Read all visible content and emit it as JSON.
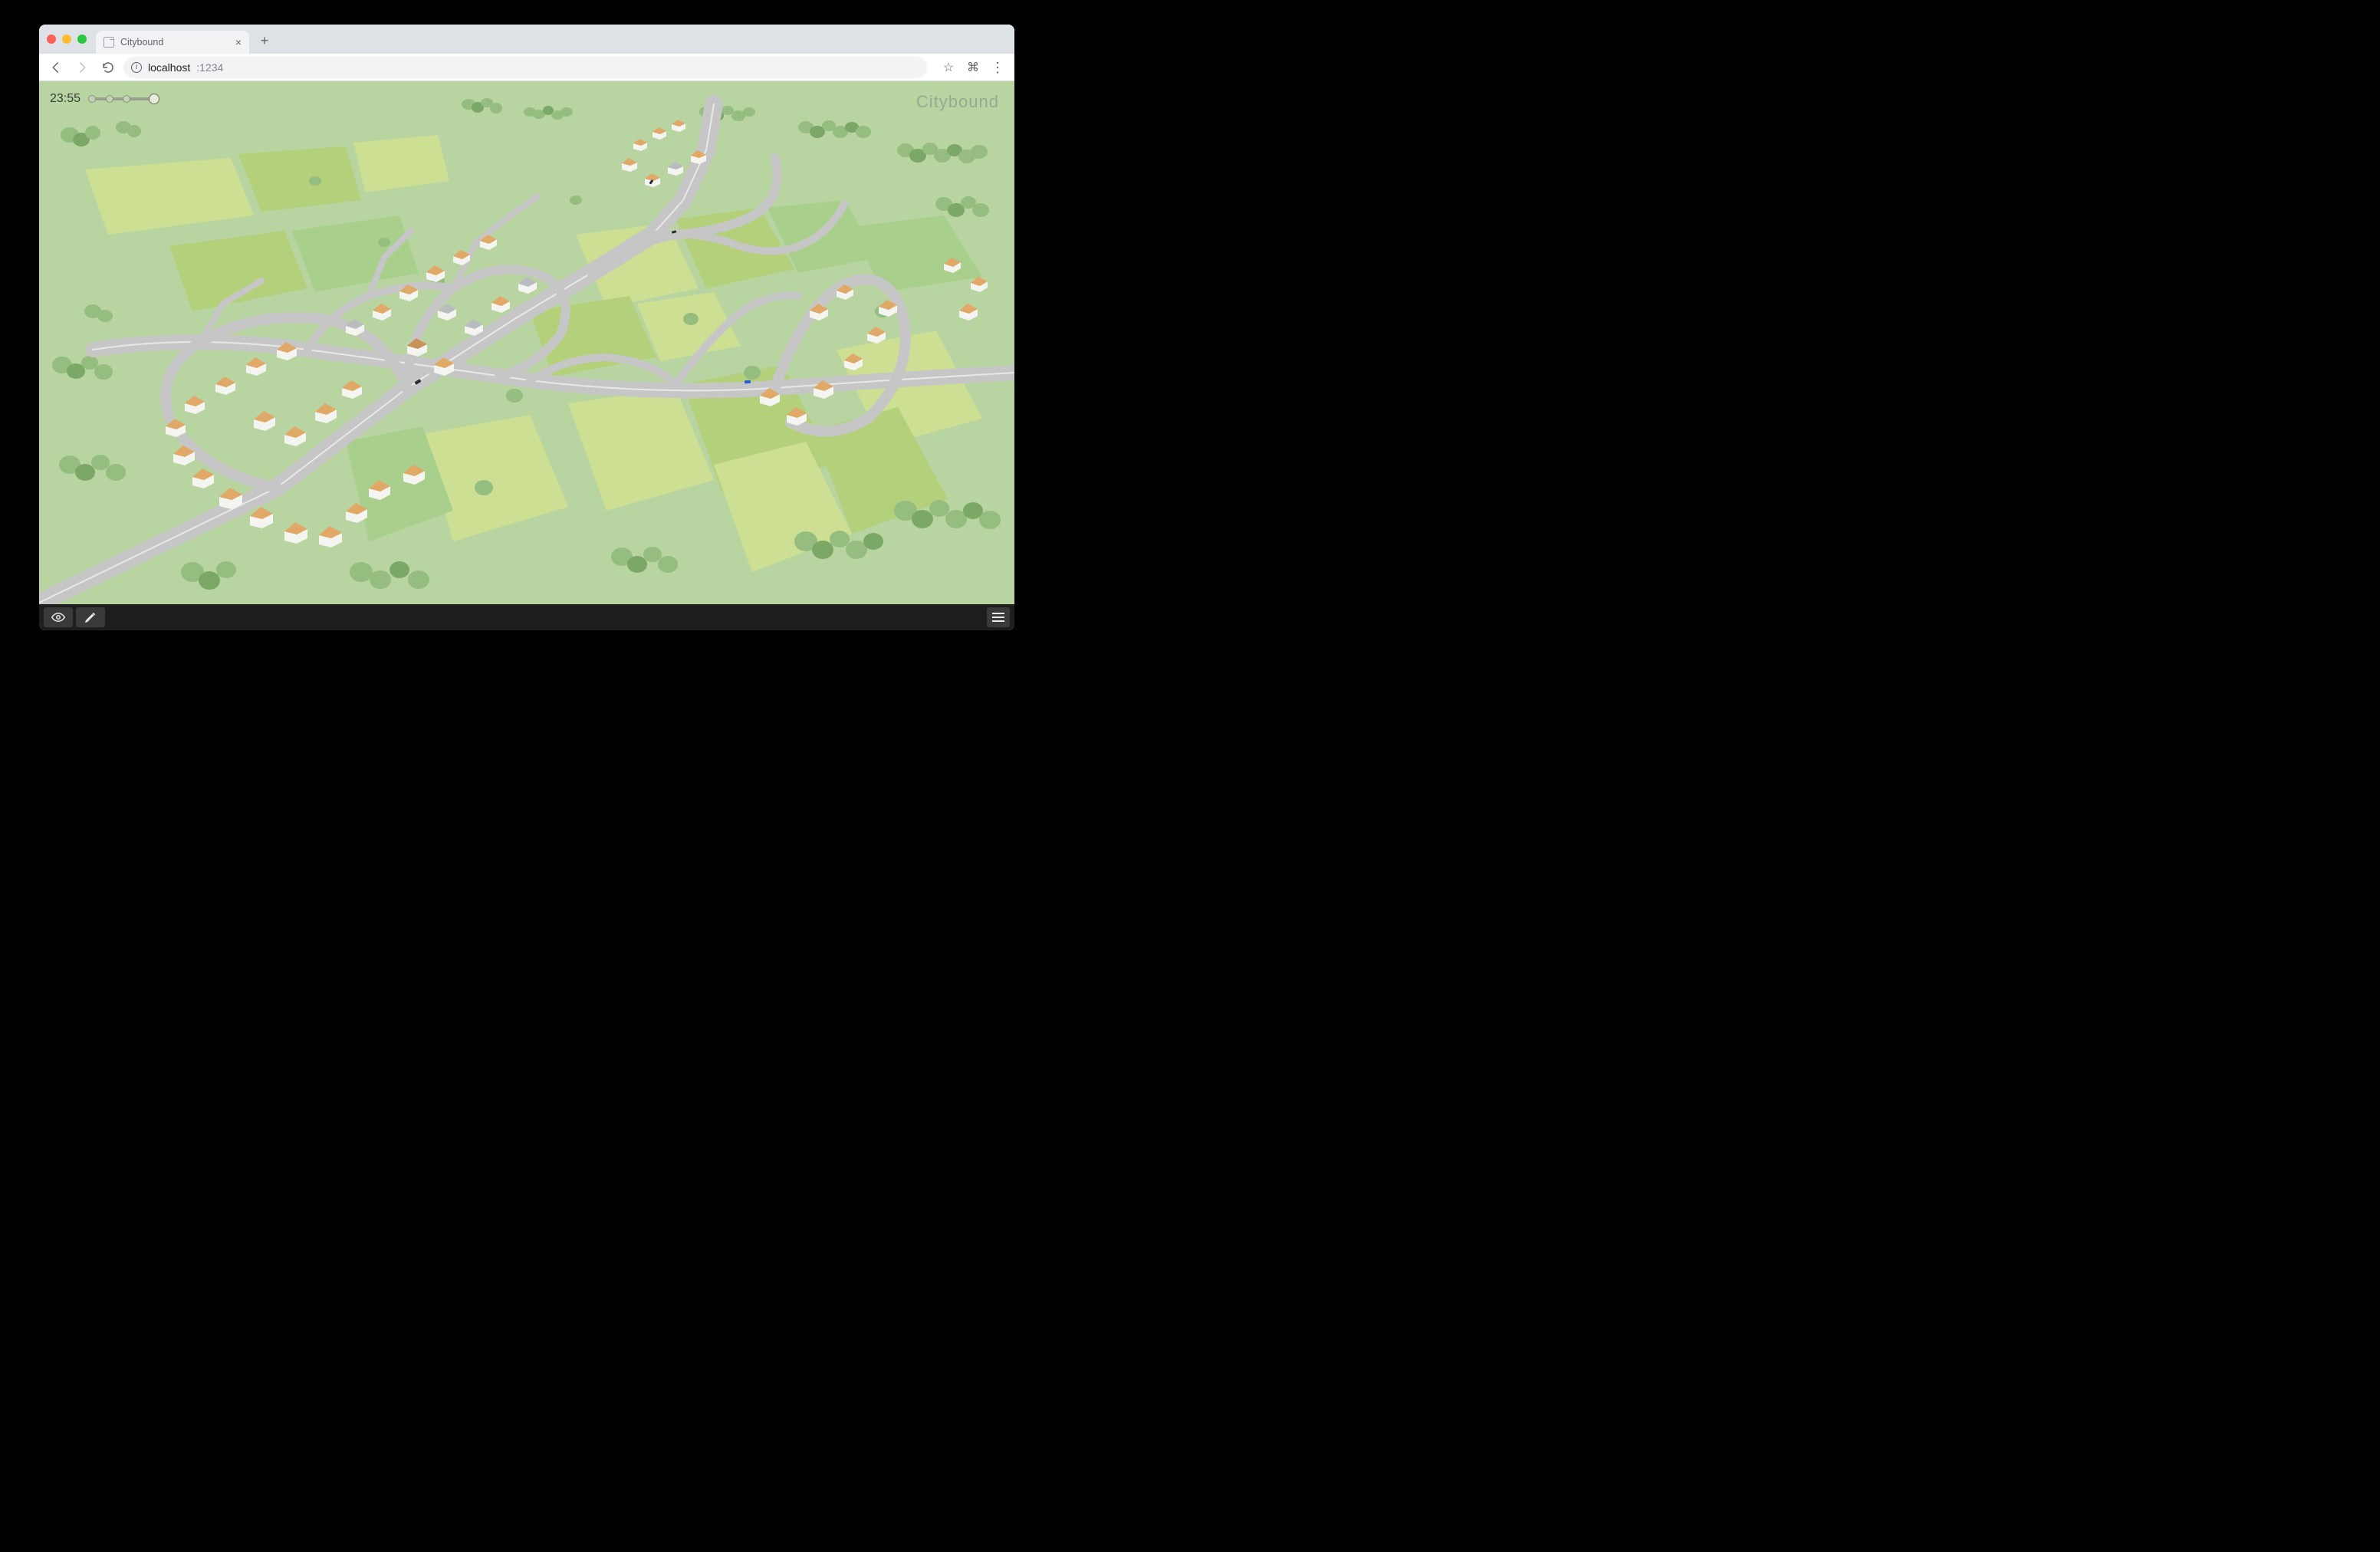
{
  "browser": {
    "tab_title": "Citybound",
    "url_host": "localhost",
    "url_port": ":1234",
    "info_glyph": "i",
    "close_glyph": "×",
    "newtab_glyph": "+",
    "menu_glyph": "⋮",
    "star_glyph": "☆",
    "ext_glyph": "⌘"
  },
  "hud": {
    "time": "23:55",
    "speed_ticks": [
      0,
      25,
      50
    ],
    "speed_knob_pct": 88
  },
  "branding": {
    "logo_text": "Citybound"
  },
  "toolbar": {
    "view_label": "view",
    "edit_label": "edit",
    "menu_label": "menu"
  },
  "colors": {
    "grass": "#b8d4a0",
    "field_a": "#cddf92",
    "field_b": "#b5d07a",
    "field_c": "#a8cf8c",
    "road": "#c6c6c6",
    "roof": "#e0a968",
    "wall": "#f4f4f0",
    "tree": "#94bd7f"
  }
}
